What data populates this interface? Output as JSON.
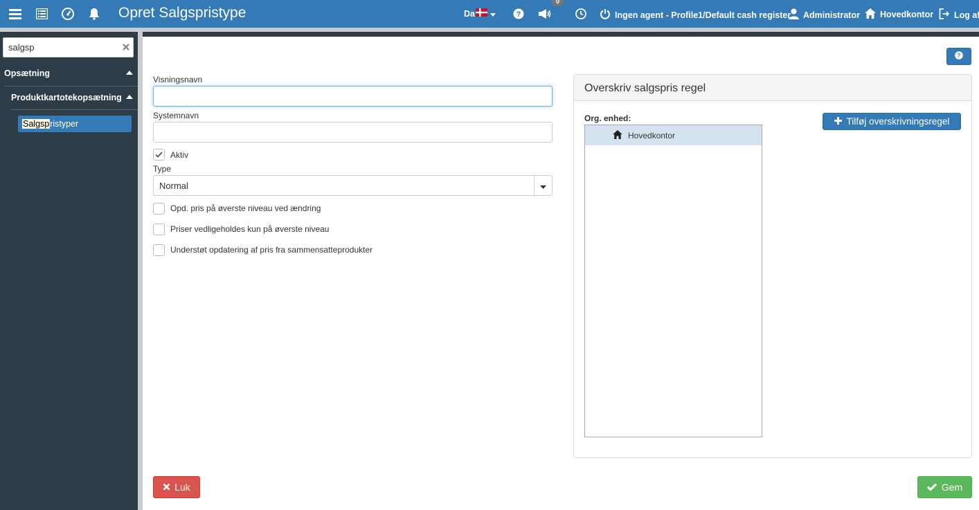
{
  "header": {
    "title": "Opret Salgspristype",
    "language": "Da",
    "notification_count": "0",
    "agent_status": "Ingen agent - Profile1/Default cash register",
    "user": "Administrator",
    "office": "Hovedkontor",
    "logout": "Log af"
  },
  "sidebar": {
    "search_value": "salgsp",
    "section_label": "Opsætning",
    "subsection_label": "Produktkartotekopsætning",
    "active_item_highlight": "Salgsp",
    "active_item_rest": "ristyper"
  },
  "form": {
    "display_name_label": "Visningsnavn",
    "display_name_value": "",
    "system_name_label": "Systemnavn",
    "system_name_value": "",
    "active_label": "Aktiv",
    "type_label": "Type",
    "type_value": "Normal",
    "option1_label": "Opd. pris på øverste niveau ved ændring",
    "option2_label": "Priser vedligeholdes kun på øverste niveau",
    "option3_label": "Understøt opdatering af pris fra sammensatteprodukter"
  },
  "panel": {
    "title": "Overskriv salgspris regel",
    "org_label": "Org. enhed:",
    "tree_root": "Hovedkontor",
    "add_button": "Tilføj overskrivningsregel"
  },
  "footer": {
    "close_button": "Luk",
    "save_button": "Gem"
  },
  "colors": {
    "primary": "#337ab7",
    "danger": "#d9534f",
    "success": "#5cb85c",
    "sidebar": "#2d3c46"
  },
  "checkboxes": {
    "active": true,
    "option1": false,
    "option2": false,
    "option3": false
  }
}
